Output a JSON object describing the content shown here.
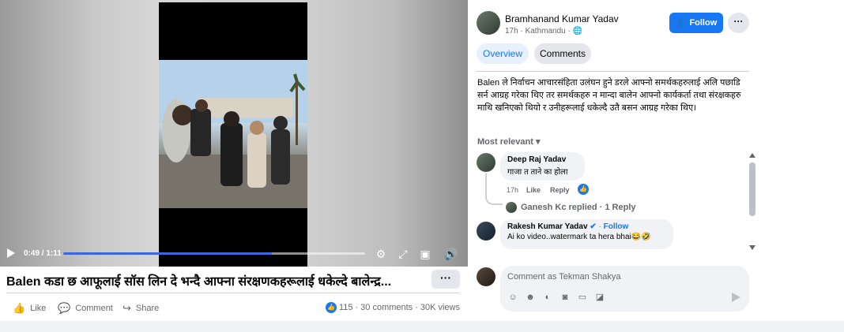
{
  "video": {
    "time": "0:49 / 1:11",
    "progress": 0.69,
    "play_icon": "play-icon",
    "settings_icon": "gear-icon",
    "expand_icon": "expand-icon",
    "pip_icon": "picture-in-picture-icon",
    "volume_icon": "volume-icon"
  },
  "post": {
    "title": "Balen कडा छ आफूलाई सॉस लिन दे भन्दै आफ्ना संरक्षणकहरूलाई धकेल्दे बालेन्द्र...",
    "more": "···",
    "actions": {
      "like": "Like",
      "comment": "Comment",
      "share": "Share"
    },
    "stats": {
      "reactions": "115",
      "comments": "30 comments",
      "views": "30K views"
    }
  },
  "author": {
    "name": "Bramhanand Kumar Yadav",
    "meta": "17h · Kathmandu · ",
    "follow": "Follow",
    "more": "···"
  },
  "tabs": {
    "overview": "Overview",
    "comments": "Comments"
  },
  "description": "Balen ले निर्वाचन आचारसंहिता उलंघन हुने डरले आफ्नो समर्थकहरुलाई अलि पछाडि सर्न आग्रह गरेका थिए तर समर्थकहरु न मान्दा बालेन आफ्नो कार्यकर्ता तथा संरक्षकहरु माथि खनिएको थियो र उनीहरूलाई धकेल्दै उतै बसन आग्रह गरेका थिए।",
  "sort": "Most relevant",
  "comments": [
    {
      "name": "Deep Raj Yadav",
      "text": "गाजा त ताने का होला",
      "time": "17h",
      "like": "Like",
      "reply": "Reply",
      "replies_text": "Ganesh Kc replied · 1 Reply"
    },
    {
      "name": "Rakesh Kumar Yadav",
      "follow": "Follow",
      "text": "Ai ko video..watermark ta hera bhai😂🤣"
    }
  ],
  "composer": {
    "placeholder": "Comment as Tekman Shakya"
  },
  "colors": {
    "accent": "#1877f2",
    "bubble": "#f0f2f5",
    "muted": "#65676b"
  }
}
